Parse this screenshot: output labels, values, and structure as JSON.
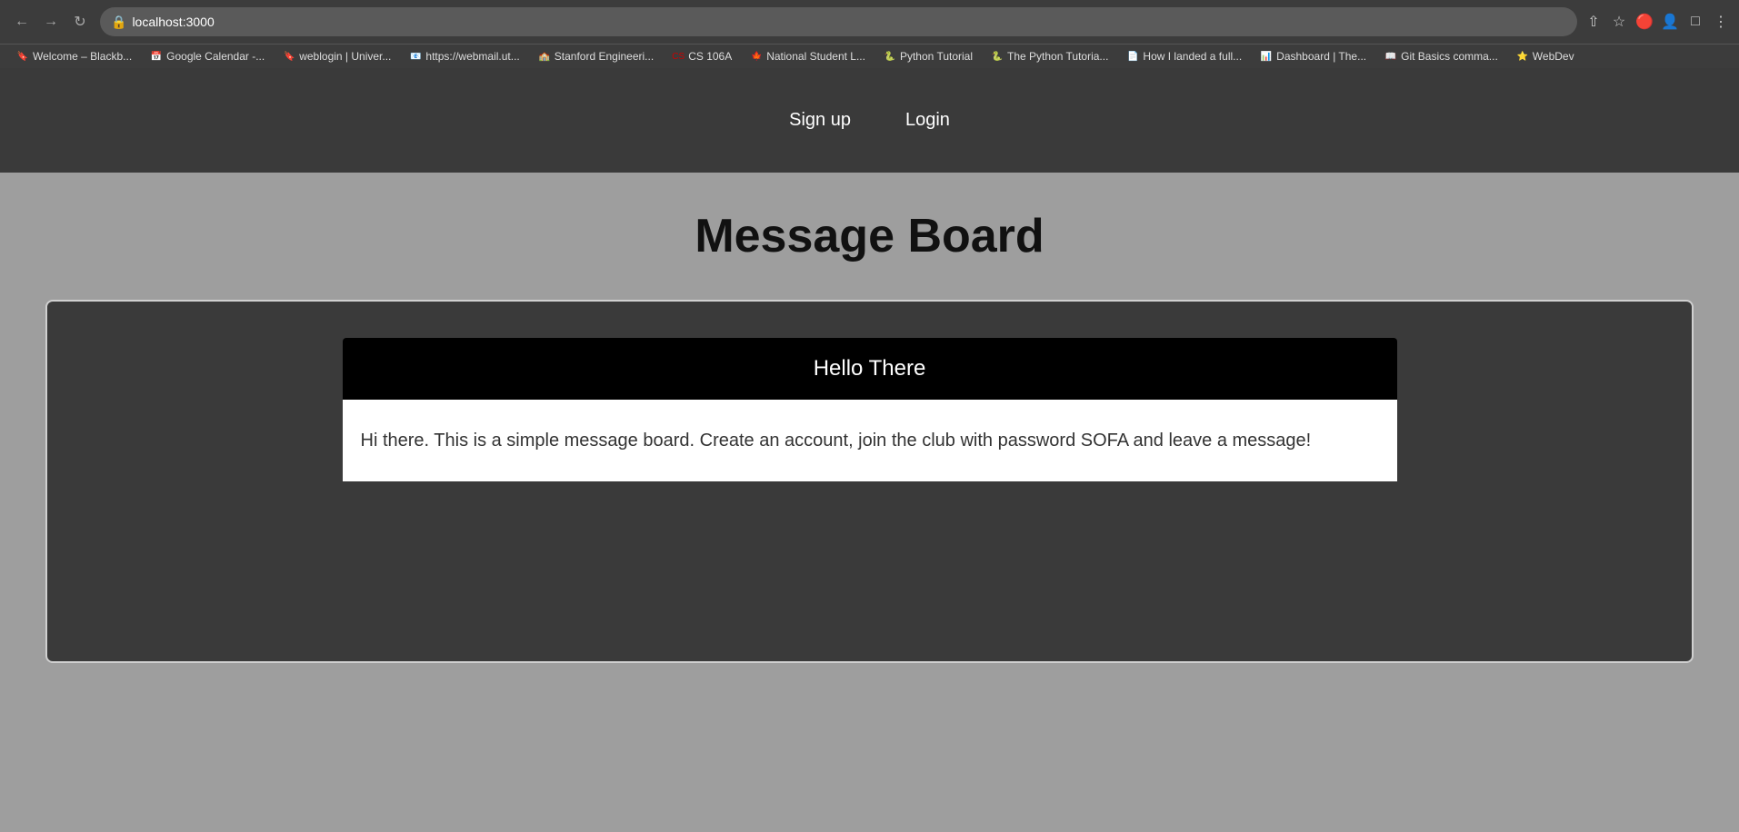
{
  "browser": {
    "address": "localhost:3000",
    "bookmarks": [
      {
        "label": "Welcome – Blackb...",
        "color": "#4a90d9",
        "icon": "🔖"
      },
      {
        "label": "Google Calendar -...",
        "color": "#4a90d9",
        "icon": "📅"
      },
      {
        "label": "weblogin | Univer...",
        "color": "#4a90d9",
        "icon": "🔖"
      },
      {
        "label": "https://webmail.ut...",
        "color": "#4a90d9",
        "icon": "📧"
      },
      {
        "label": "Stanford Engineeri...",
        "color": "#b22222",
        "icon": "🏫"
      },
      {
        "label": "CS 106A",
        "color": "#cc0000",
        "icon": "📚"
      },
      {
        "label": "National Student L...",
        "color": "#cc0000",
        "icon": "🍁"
      },
      {
        "label": "Python Tutorial",
        "color": "#f5a623",
        "icon": "🐍"
      },
      {
        "label": "The Python Tutoria...",
        "color": "#f5a623",
        "icon": "🐍"
      },
      {
        "label": "How I landed a full...",
        "color": "#4a90d9",
        "icon": "📄"
      },
      {
        "label": "Dashboard | The...",
        "color": "#4a4a4a",
        "icon": "📊"
      },
      {
        "label": "Git Basics comma...",
        "color": "#4a90d9",
        "icon": "📖"
      },
      {
        "label": "WebDev",
        "color": "#ffd700",
        "icon": "⭐"
      }
    ]
  },
  "navbar": {
    "signup_label": "Sign up",
    "login_label": "Login"
  },
  "page": {
    "title": "Message Board"
  },
  "message": {
    "username": "Hello There",
    "body": "Hi there. This is a simple message board. Create an account, join the club with password SOFA and leave a message!"
  }
}
